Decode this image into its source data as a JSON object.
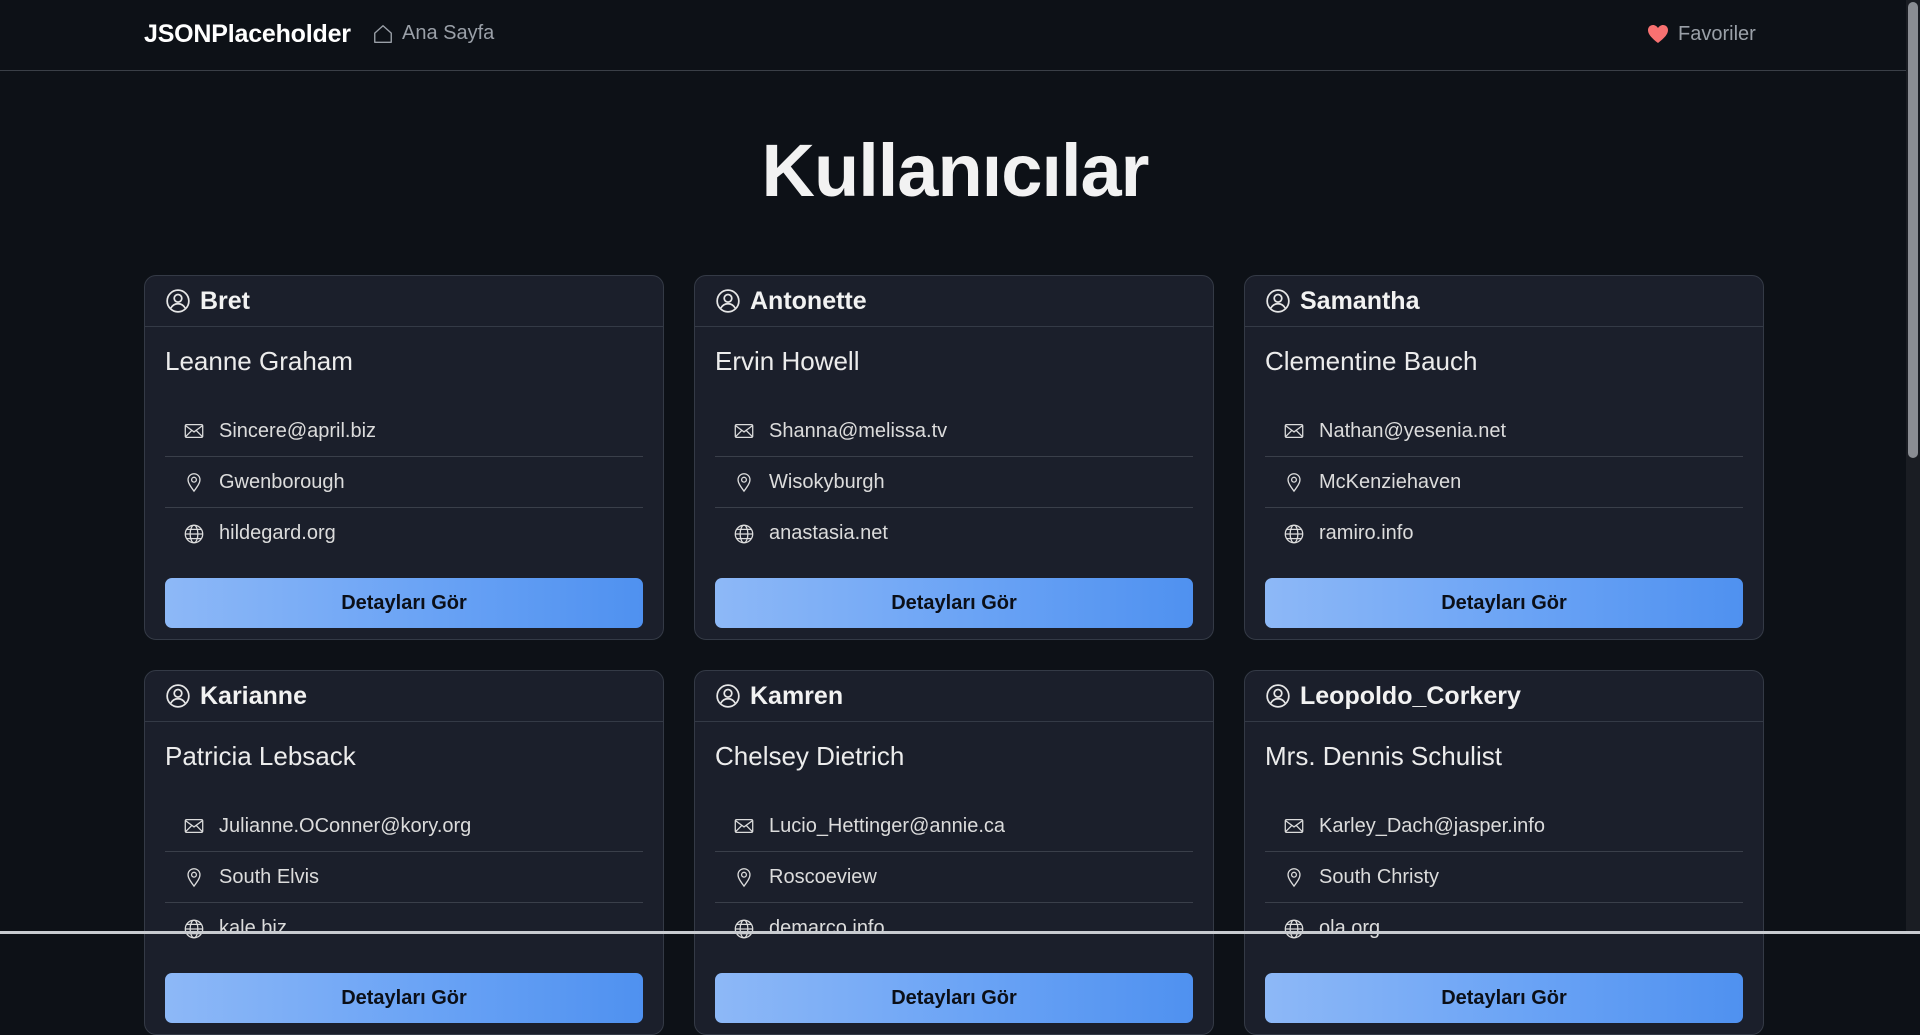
{
  "navbar": {
    "brand": "JSONPlaceholder",
    "home_label": "Ana Sayfa",
    "favorites_label": "Favoriler",
    "home_icon": "home-icon",
    "favorites_icon": "heart-icon",
    "heart_color": "#f87171"
  },
  "page": {
    "title": "Kullanıcılar"
  },
  "button_label": "Detayları Gör",
  "users": [
    {
      "username": "Bret",
      "name": "Leanne Graham",
      "email": "Sincere@april.biz",
      "city": "Gwenborough",
      "website": "hildegard.org"
    },
    {
      "username": "Antonette",
      "name": "Ervin Howell",
      "email": "Shanna@melissa.tv",
      "city": "Wisokyburgh",
      "website": "anastasia.net"
    },
    {
      "username": "Samantha",
      "name": "Clementine Bauch",
      "email": "Nathan@yesenia.net",
      "city": "McKenziehaven",
      "website": "ramiro.info"
    },
    {
      "username": "Karianne",
      "name": "Patricia Lebsack",
      "email": "Julianne.OConner@kory.org",
      "city": "South Elvis",
      "website": "kale.biz"
    },
    {
      "username": "Kamren",
      "name": "Chelsey Dietrich",
      "email": "Lucio_Hettinger@annie.ca",
      "city": "Roscoeview",
      "website": "demarco.info"
    },
    {
      "username": "Leopoldo_Corkery",
      "name": "Mrs. Dennis Schulist",
      "email": "Karley_Dach@jasper.info",
      "city": "South Christy",
      "website": "ola.org"
    }
  ],
  "colors": {
    "background": "#0d1117",
    "card": "#1b1f2b",
    "button_gradient_start": "#8db8f7",
    "button_gradient_end": "#4f91f0"
  }
}
